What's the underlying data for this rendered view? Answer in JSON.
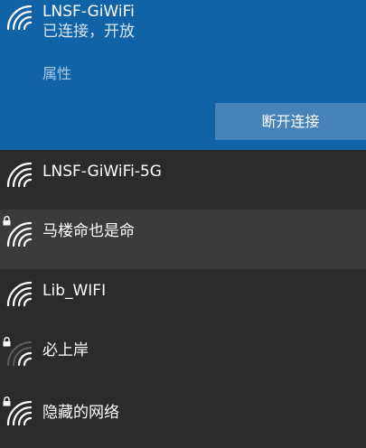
{
  "connected_network": {
    "name": "LNSF-GiWiFi",
    "status": "已连接，开放",
    "properties_label": "属性",
    "disconnect_label": "断开连接",
    "icon": "wifi-signal-icon",
    "signal_bars": 4,
    "secured": false
  },
  "networks": [
    {
      "name": "LNSF-GiWiFi-5G",
      "icon": "wifi-signal-icon",
      "signal_bars": 4,
      "secured": false,
      "highlighted": false
    },
    {
      "name": "马楼命也是命",
      "icon": "wifi-signal-icon",
      "signal_bars": 4,
      "secured": true,
      "highlighted": true
    },
    {
      "name": "Lib_WIFI",
      "icon": "wifi-signal-icon",
      "signal_bars": 4,
      "secured": false,
      "highlighted": false
    },
    {
      "name": "必上岸",
      "icon": "wifi-signal-icon",
      "signal_bars": 2,
      "secured": true,
      "highlighted": false
    },
    {
      "name": "隐藏的网络",
      "icon": "wifi-signal-icon",
      "signal_bars": 4,
      "secured": true,
      "highlighted": false
    }
  ],
  "colors": {
    "connected_bg": "#1163a8",
    "list_bg": "#2b2b2b",
    "hover_bg": "#3b3b3b",
    "button_bg": "#4683bb",
    "link_color": "#a8cbec"
  }
}
